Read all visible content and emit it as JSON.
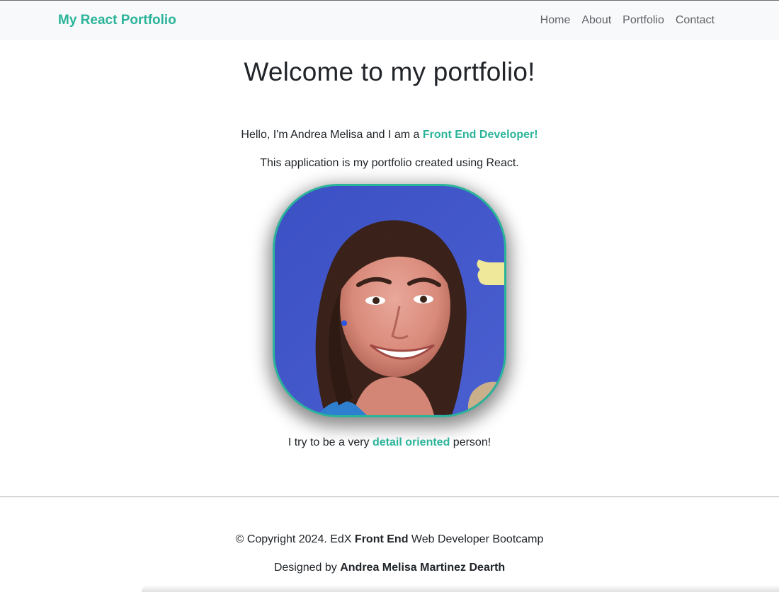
{
  "navbar": {
    "brand": "My React Portfolio",
    "links": [
      "Home",
      "About",
      "Portfolio",
      "Contact"
    ]
  },
  "main": {
    "title": "Welcome to my portfolio!",
    "intro_prefix": "Hello, I'm Andrea Melisa and I am a ",
    "intro_accent": "Front End Developer!",
    "subtitle": "This application is my portfolio created using React.",
    "detail_prefix": "I try to be a very ",
    "detail_accent": "detail oriented",
    "detail_suffix": " person!"
  },
  "footer": {
    "copyright_prefix": "© Copyright 2024. EdX ",
    "copyright_bold": "Front End",
    "copyright_suffix": " Web Developer Bootcamp",
    "designed_prefix": "Designed by ",
    "designed_name": "Andrea Melisa Martinez Dearth"
  },
  "colors": {
    "accent": "#2bb49a",
    "navbar_bg": "#f8f9fa",
    "photo_bg": "#3f54c9"
  }
}
